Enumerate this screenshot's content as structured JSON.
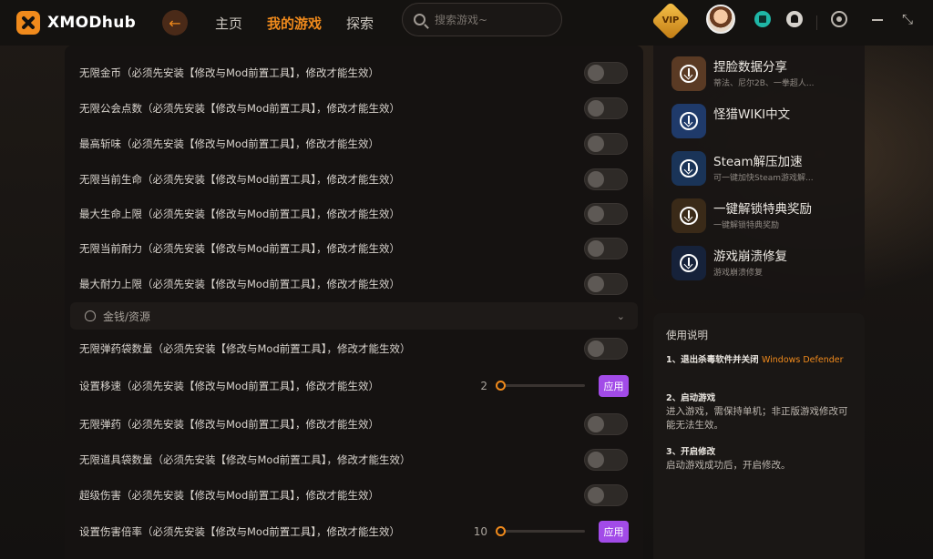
{
  "app": {
    "name": "XMODhub"
  },
  "nav": {
    "items": [
      "主页",
      "我的游戏",
      "探索"
    ],
    "active": 1
  },
  "search": {
    "placeholder": "搜索游戏~"
  },
  "vip": {
    "label": "VIP"
  },
  "options": [
    {
      "label": "无限金币（必须先安装【修改与Mod前置工具】，修改才能生效）",
      "control": "toggle",
      "enabled": false
    },
    {
      "label": "无限公会点数（必须先安装【修改与Mod前置工具】，修改才能生效）",
      "control": "toggle",
      "enabled": false
    },
    {
      "label": "最高斩味（必须先安装【修改与Mod前置工具】，修改才能生效）",
      "control": "toggle",
      "enabled": false
    },
    {
      "label": "无限当前生命（必须先安装【修改与Mod前置工具】，修改才能生效）",
      "control": "toggle",
      "enabled": false
    },
    {
      "label": "最大生命上限（必须先安装【修改与Mod前置工具】，修改才能生效）",
      "control": "toggle",
      "enabled": false
    },
    {
      "label": "无限当前耐力（必须先安装【修改与Mod前置工具】，修改才能生效）",
      "control": "toggle",
      "enabled": false
    },
    {
      "label": "最大耐力上限（必须先安装【修改与Mod前置工具】，修改才能生效）",
      "control": "toggle",
      "enabled": false
    }
  ],
  "section": {
    "label": "金钱/资源"
  },
  "section_options": [
    {
      "label": "无限弹药袋数量（必须先安装【修改与Mod前置工具】，修改才能生效）",
      "control": "toggle",
      "enabled": false
    },
    {
      "label": "设置移速（必须先安装【修改与Mod前置工具】，修改才能生效）",
      "control": "slider",
      "value": "2",
      "fraction": 0.02,
      "button": "应用"
    },
    {
      "label": "无限弹药（必须先安装【修改与Mod前置工具】，修改才能生效）",
      "control": "toggle",
      "enabled": false
    },
    {
      "label": "无限道具袋数量（必须先安装【修改与Mod前置工具】，修改才能生效）",
      "control": "toggle",
      "enabled": false
    },
    {
      "label": "超级伤害（必须先安装【修改与Mod前置工具】，修改才能生效）",
      "control": "toggle",
      "enabled": false
    },
    {
      "label": "设置伤害倍率（必须先安装【修改与Mod前置工具】，修改才能生效）",
      "control": "slider",
      "value": "10",
      "fraction": 0.02,
      "button": "应用"
    }
  ],
  "tools": [
    {
      "title": "捏脸数据分享",
      "subtitle": "蒂法、尼尔2B、一拳超人...",
      "color": "#5a3a24"
    },
    {
      "title": "怪猎WIKI中文",
      "subtitle": "",
      "color": "#1f3a6a"
    },
    {
      "title": "Steam解压加速",
      "subtitle": "可一键加快Steam游戏解...",
      "color": "#1a3458"
    },
    {
      "title": "一键解锁特典奖励",
      "subtitle": "一键解锁特典奖励",
      "color": "#3a2a18"
    },
    {
      "title": "游戏崩溃修复",
      "subtitle": "游戏崩溃修复",
      "color": "#16223a"
    }
  ],
  "guide": {
    "title": "使用说明",
    "steps": [
      {
        "title": "1、退出杀毒软件并关闭",
        "highlight": "Windows Defender",
        "body": ""
      },
      {
        "title": "2、启动游戏",
        "highlight": "",
        "body": "进入游戏，需保持单机；非正版游戏修改可能无法生效。"
      },
      {
        "title": "3、开启修改",
        "highlight": "",
        "body": "启动游戏成功后，开启修改。"
      }
    ]
  }
}
